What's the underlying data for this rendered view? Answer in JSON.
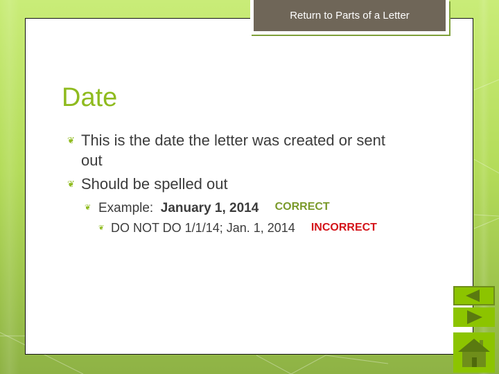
{
  "header": {
    "return_button_label": "Return to Parts of a Letter"
  },
  "slide": {
    "title": "Date",
    "bullets": [
      {
        "text": "This is the date the letter was created or sent",
        "continuation": "out"
      },
      {
        "text": "Should be spelled out"
      }
    ],
    "example": {
      "prefix": "Example:",
      "value": "January 1, 2014",
      "badge": "CORRECT"
    },
    "counter_example": {
      "text": "DO NOT DO 1/1/14; Jan. 1, 2014",
      "badge": "INCORRECT"
    }
  },
  "colors": {
    "accent_green": "#8fbb1f",
    "correct": "#7a9a2a",
    "incorrect": "#d4141a",
    "return_button_bg": "#6f6658",
    "nav_button_bg": "#8cc400",
    "nav_icon": "#5a7a10"
  },
  "navigation": {
    "prev_icon": "triangle-left-icon",
    "next_icon": "triangle-right-icon",
    "home_icon": "house-icon"
  }
}
